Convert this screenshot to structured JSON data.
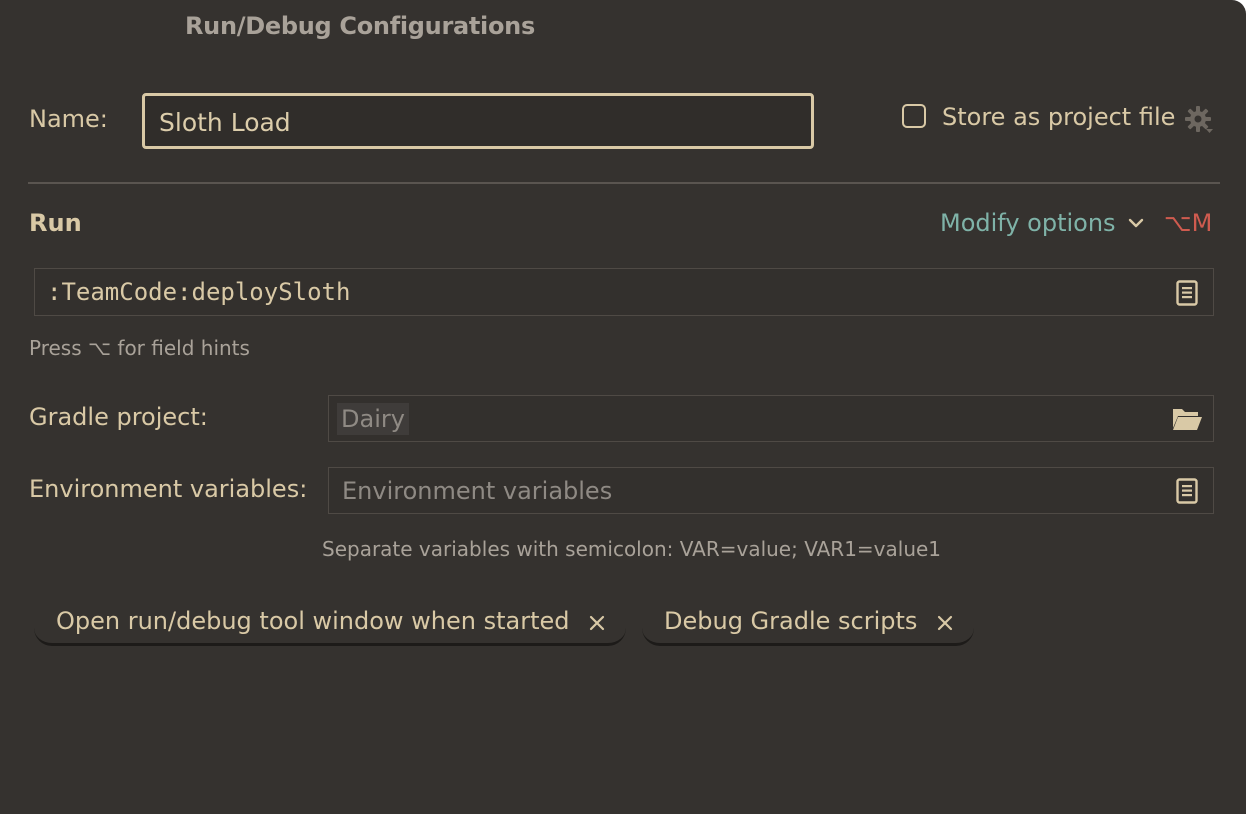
{
  "dialog": {
    "title": "Run/Debug Configurations"
  },
  "name_row": {
    "label": "Name:",
    "value": "Sloth Load",
    "store_checkbox_label": "Store as project file",
    "store_checked": false
  },
  "run_section": {
    "header": "Run",
    "modify_options": "Modify options",
    "shortcut": "⌥M",
    "task_value": ":TeamCode:deploySloth",
    "field_hint": "Press ⌥ for field hints"
  },
  "gradle_project": {
    "label": "Gradle project:",
    "value": "Dairy"
  },
  "environment": {
    "label": "Environment variables:",
    "placeholder": "Environment variables",
    "hint": "Separate variables with semicolon: VAR=value; VAR1=value1"
  },
  "tags": [
    {
      "label": "Open run/debug tool window when started"
    },
    {
      "label": "Debug Gradle scripts"
    }
  ],
  "icons": {
    "gear": "gear-icon",
    "chevron": "chevron-down-icon",
    "document": "document-icon",
    "folder": "folder-open-icon",
    "close": "close-icon"
  },
  "colors": {
    "background": "#35322f",
    "text": "#d9c9a6",
    "accent_link": "#7fb3a8",
    "shortcut": "#cf5b4f"
  }
}
